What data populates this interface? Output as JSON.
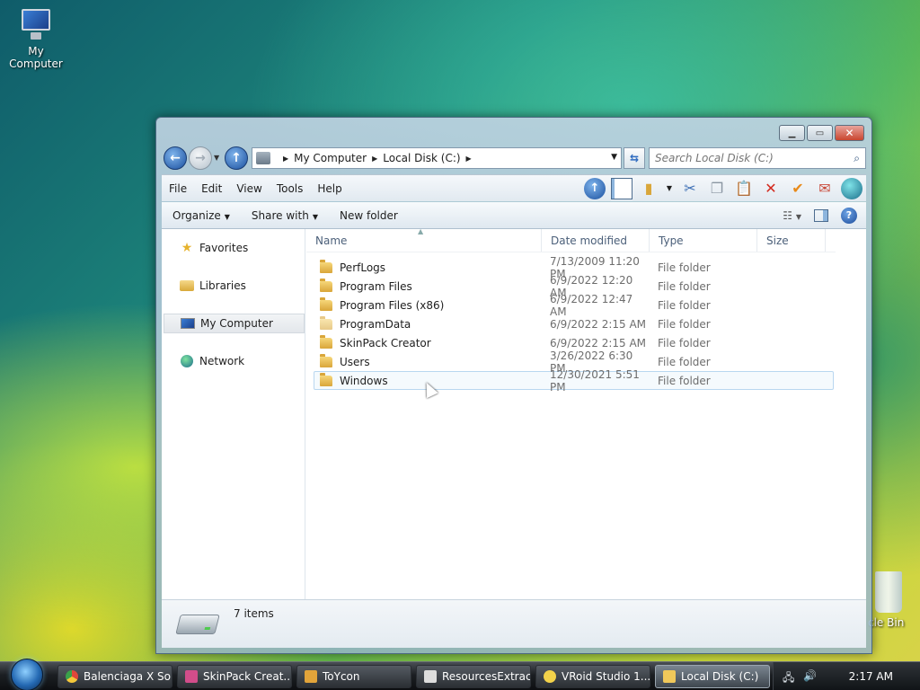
{
  "desktop": {
    "my_computer_label": "My Computer",
    "recycle_label": "cle Bin"
  },
  "window": {
    "address": {
      "crumbs": [
        "My Computer",
        "Local Disk (C:)"
      ]
    },
    "search": {
      "placeholder": "Search Local Disk (C:)"
    },
    "menu": [
      "File",
      "Edit",
      "View",
      "Tools",
      "Help"
    ],
    "commands": {
      "organize": "Organize",
      "share_with": "Share with",
      "new_folder": "New folder"
    },
    "nav_pane": {
      "favorites": "Favorites",
      "libraries": "Libraries",
      "my_computer": "My Computer",
      "network": "Network"
    },
    "columns": {
      "name": "Name",
      "date": "Date modified",
      "type": "Type",
      "size": "Size"
    },
    "files": [
      {
        "name": "PerfLogs",
        "date": "7/13/2009 11:20 PM",
        "type": "File folder"
      },
      {
        "name": "Program Files",
        "date": "6/9/2022 12:20 AM",
        "type": "File folder"
      },
      {
        "name": "Program Files (x86)",
        "date": "6/9/2022 12:47 AM",
        "type": "File folder"
      },
      {
        "name": "ProgramData",
        "date": "6/9/2022 2:15 AM",
        "type": "File folder"
      },
      {
        "name": "SkinPack Creator",
        "date": "6/9/2022 2:15 AM",
        "type": "File folder"
      },
      {
        "name": "Users",
        "date": "3/26/2022 6:30 PM",
        "type": "File folder"
      },
      {
        "name": "Windows",
        "date": "12/30/2021 5:51 PM",
        "type": "File folder"
      }
    ],
    "status": {
      "items": "7 items"
    }
  },
  "taskbar": {
    "buttons": [
      {
        "label": "Balenciaga X So...",
        "color": "#e0473a"
      },
      {
        "label": "SkinPack Creat...",
        "color": "#d14d8a"
      },
      {
        "label": "ToYcon",
        "color": "#e2a43a"
      },
      {
        "label": "ResourcesExtract",
        "color": "#dddddd"
      },
      {
        "label": "VRoid Studio 1....",
        "color": "#f3d24a"
      },
      {
        "label": "Local Disk (C:)",
        "color": "#f0c85a"
      }
    ],
    "clock": "2:17 AM"
  }
}
